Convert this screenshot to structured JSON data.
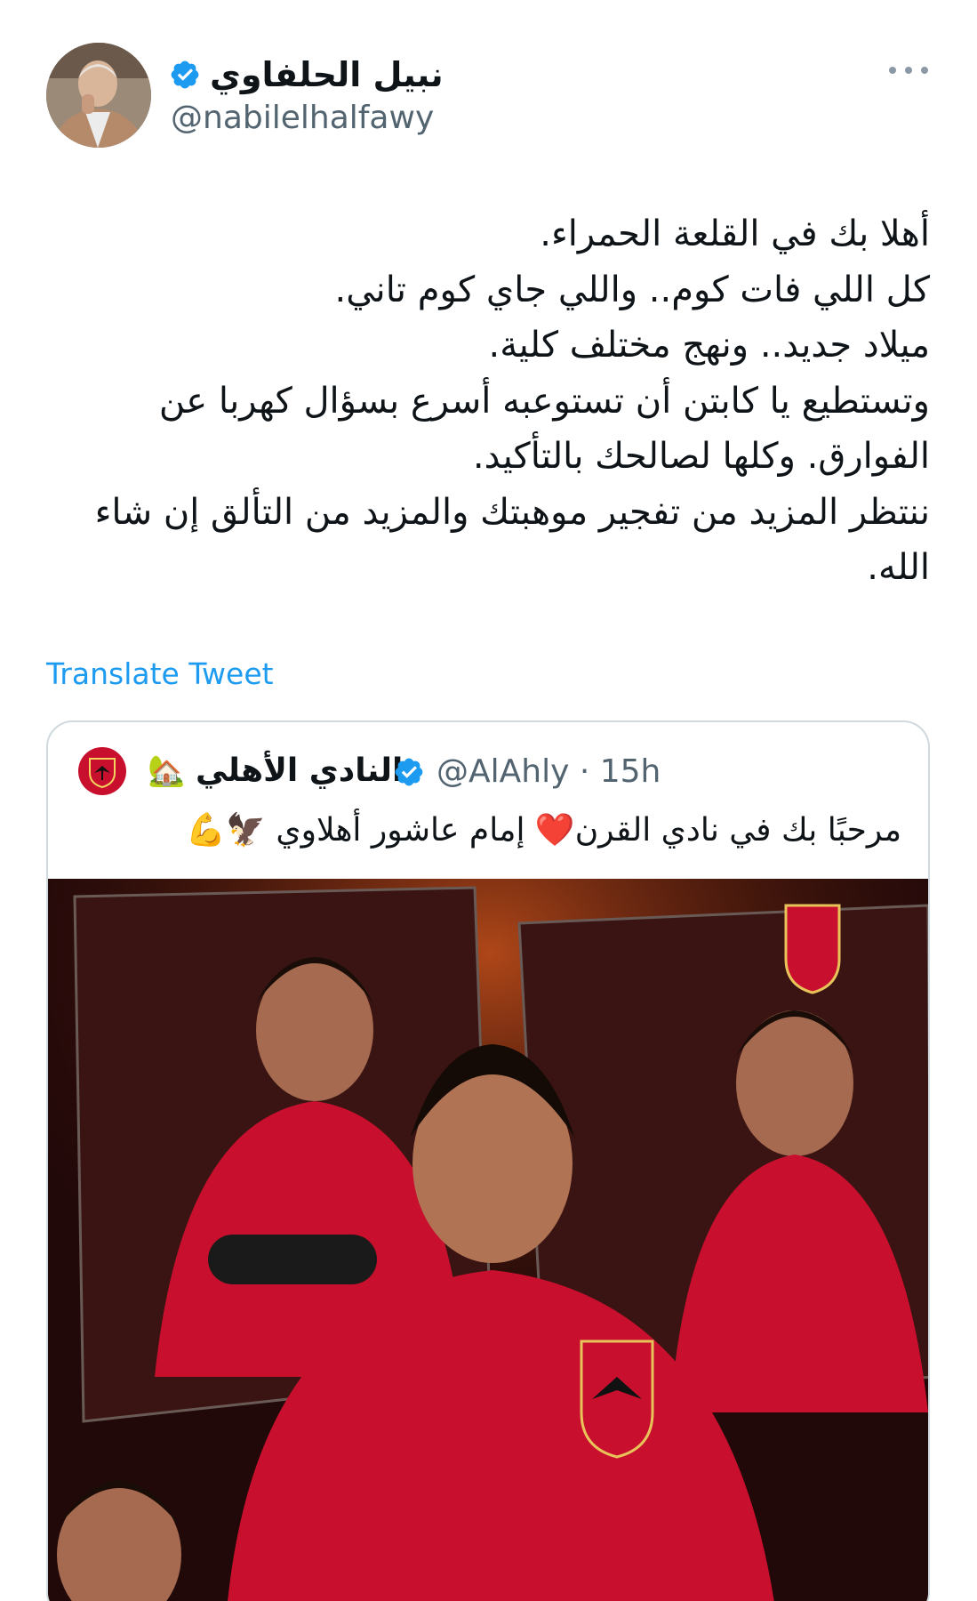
{
  "tweet": {
    "author": {
      "display_name": "نبيل الحلفاوي",
      "handle": "@nabilelhalfawy",
      "verified": true
    },
    "more_icon": "more-dots-icon",
    "text_lines": [
      "أهلا بك في القلعة الحمراء.",
      "كل اللي فات كوم.. واللي جاي كوم تاني.",
      "ميلاد جديد.. ونهج مختلف كلية.",
      "وتستطيع يا كابتن أن تستوعبه أسرع بسؤال كهربا عن الفوارق. وكلها لصالحك بالتأكيد.",
      "ننتظر المزيد من تفجير موهبتك والمزيد من التألق إن شاء الله."
    ],
    "translate_label": "Translate Tweet"
  },
  "quoted_tweet": {
    "display_name": "النادي الأهلي",
    "name_emoji": "🏡",
    "handle_time": "@AlAhly · 15h",
    "verified": true,
    "text": "مرحبًا بك في نادي القرن❤️ إمام عاشور أهلاوي 🦅💪",
    "media_alt": "player-photo"
  },
  "colors": {
    "link": "#1d9bf0",
    "verified": "#1d9bf0",
    "secondary_text": "#536471",
    "border": "#cfd9de",
    "club_red": "#c8102e"
  }
}
